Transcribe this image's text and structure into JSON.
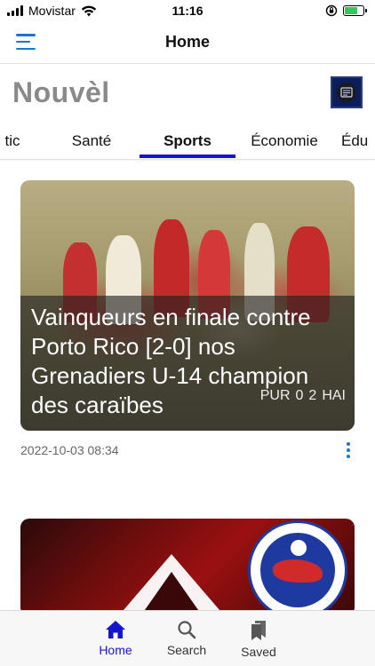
{
  "status_bar": {
    "carrier": "Movistar",
    "time": "11:16"
  },
  "navbar": {
    "title": "Home",
    "menu_icon": "hamburger-menu-icon",
    "accent_color": "#1976d2"
  },
  "brand": {
    "title": "Nouvèl",
    "logo_icon": "newspaper-icon"
  },
  "category_tabs": {
    "items": [
      {
        "label": "tic"
      },
      {
        "label": "Santé"
      },
      {
        "label": "Sports",
        "active": true
      },
      {
        "label": "Économie"
      },
      {
        "label": "Édu"
      }
    ],
    "active_color": "#1514d1"
  },
  "feed": {
    "articles": [
      {
        "headline": "Vainqueurs en finale contre Porto Rico [2-0] nos Grenadiers U-14 champion des caraïbes",
        "score_left": "0",
        "score_right": "2",
        "team_left": "PUR",
        "team_right": "HAI",
        "date": "2022-10-03 08:34",
        "more_icon": "more-vertical-icon"
      },
      {
        "image": "Association Haïtienne de Football crest"
      }
    ]
  },
  "tabbar": {
    "items": [
      {
        "label": "Home",
        "icon": "home-icon",
        "active": true
      },
      {
        "label": "Search",
        "icon": "search-icon"
      },
      {
        "label": "Saved",
        "icon": "bookmarks-icon"
      }
    ],
    "active_color": "#1514d1"
  }
}
